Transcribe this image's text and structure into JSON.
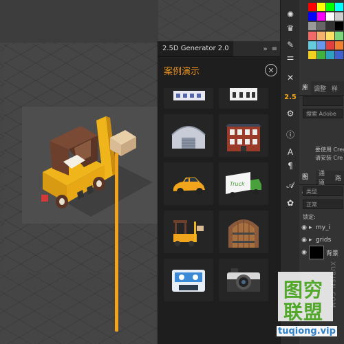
{
  "panel": {
    "tab_title": "2.5D Generator 2.0",
    "header_title": "案例演示",
    "collapse_glyph": "»",
    "menu_glyph": "≡",
    "close_glyph": "✕",
    "tiles": [
      {
        "name": "building-a-thumb"
      },
      {
        "name": "building-b-thumb"
      },
      {
        "name": "warehouse-thumb"
      },
      {
        "name": "brick-house-thumb"
      },
      {
        "name": "car-thumb"
      },
      {
        "name": "truck-thumb"
      },
      {
        "name": "forklift-thumb"
      },
      {
        "name": "wooden-door-thumb"
      },
      {
        "name": "cassette-thumb"
      },
      {
        "name": "camera-thumb"
      }
    ],
    "truck_text": "Truck"
  },
  "toolbar": {
    "badge_25": "2.5",
    "tools": [
      "sun-icon",
      "crown-icon",
      "brush-icon",
      "adjust-icon",
      "sliders-icon",
      "swap-icon",
      "x-icon",
      "info-icon",
      "type-a-icon",
      "pilcrow-icon",
      "script-a-icon",
      "gear-icon"
    ]
  },
  "right_panel": {
    "tabs_top": {
      "library": "库",
      "adjust": "调整",
      "third": "样"
    },
    "search_placeholder": "搜索 Adobe",
    "cc_msg_1": "要使用 Crea",
    "cc_msg_2": "请安装 Cre",
    "tabs_layers": {
      "layers": "图层",
      "channels": "通道",
      "paths": "路"
    },
    "filter_kind": "类型",
    "blend_mode": "正常",
    "lock_label": "锁定:",
    "layers": [
      {
        "name": "my_i",
        "kind": "folder"
      },
      {
        "name": "grids",
        "kind": "folder"
      },
      {
        "name": "背景",
        "kind": "background"
      }
    ]
  },
  "watermark": {
    "line1": "图穷",
    "line2": "联盟",
    "url": "tuqiong.vip",
    "vertical": "XURISN.COM"
  },
  "colors": {
    "accent_orange": "#f1a51c",
    "panel_bg": "#1e1e1e",
    "watermark_green": "#52a82a",
    "watermark_blue": "#2d7fc8"
  }
}
